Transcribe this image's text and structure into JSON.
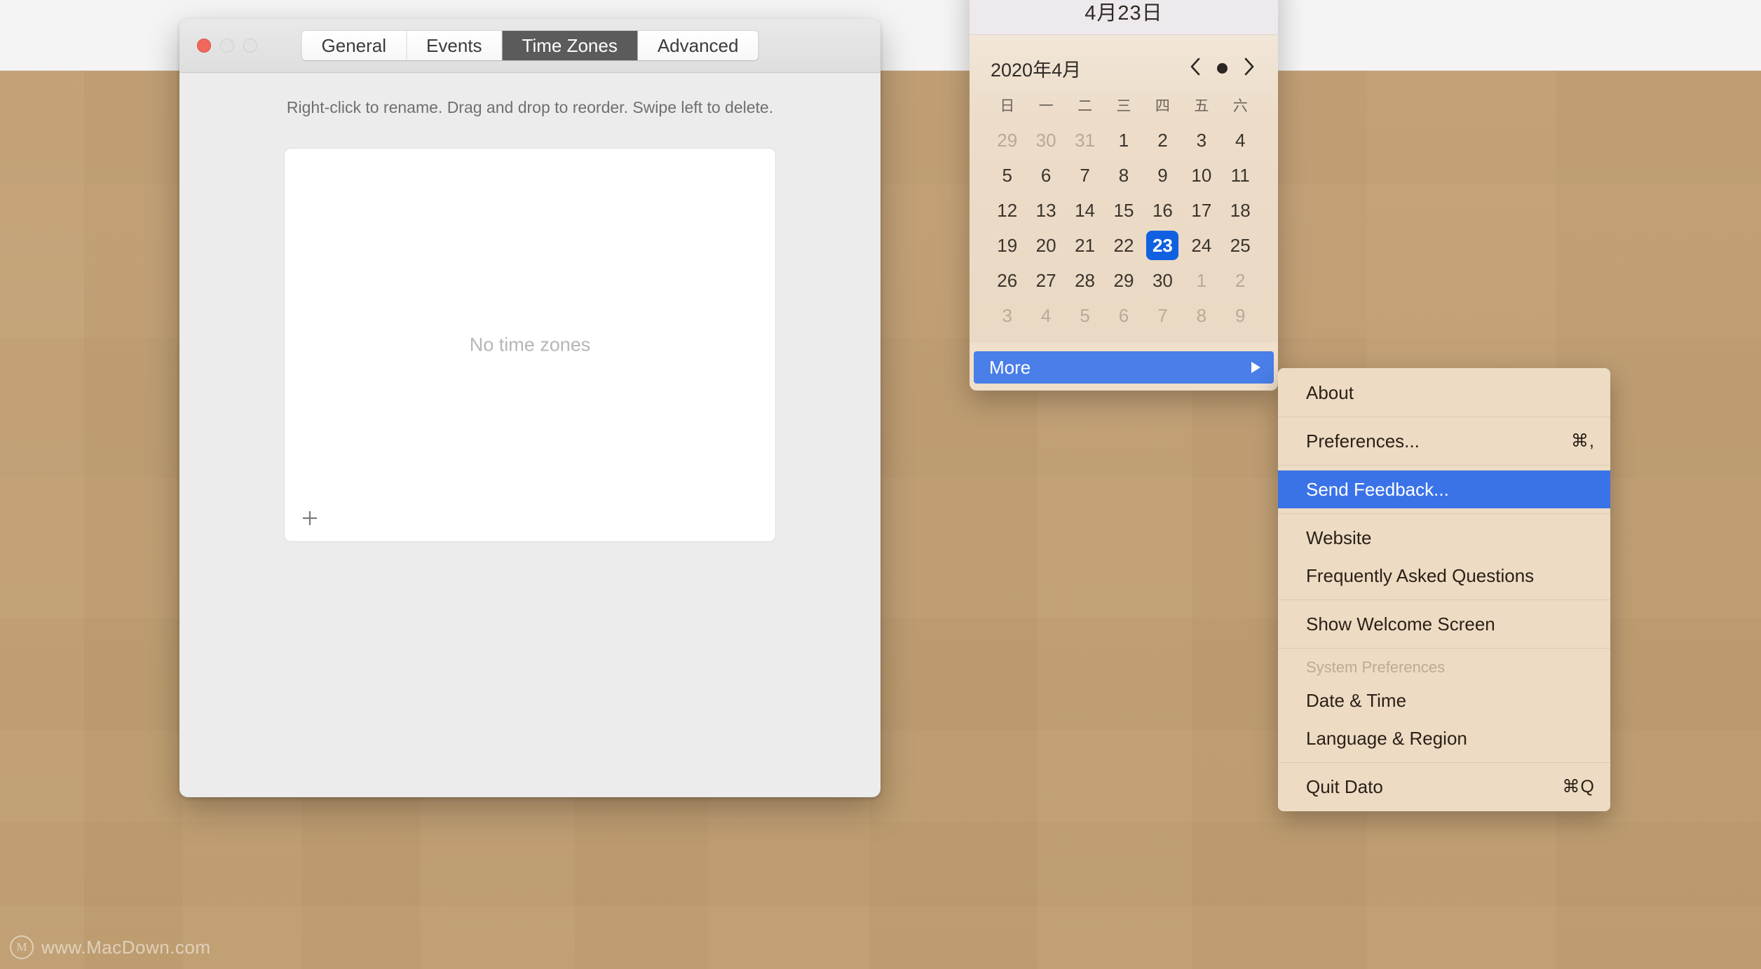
{
  "desktop": {
    "wallpaper_color": "#c3a176",
    "menubar_color": "#f4f4f5"
  },
  "watermark": {
    "logo_letter": "M",
    "text": "www.MacDown.com"
  },
  "prefs_window": {
    "traffic_lights": {
      "close_label": "close",
      "minimize_label": "minimize",
      "zoom_label": "zoom"
    },
    "tabs": [
      {
        "label": "General",
        "active": false
      },
      {
        "label": "Events",
        "active": false
      },
      {
        "label": "Time Zones",
        "active": true
      },
      {
        "label": "Advanced",
        "active": false
      }
    ],
    "hint": "Right-click to rename. Drag and drop to reorder. Swipe left to delete.",
    "empty_state": "No time zones",
    "add_button_label": "+"
  },
  "popover": {
    "header_title": "4月23日",
    "month_label": "2020年4月",
    "nav": {
      "prev": "‹",
      "today": "today-dot",
      "next": "›"
    },
    "weekdays": [
      "日",
      "一",
      "二",
      "三",
      "四",
      "五",
      "六"
    ],
    "weeks": [
      [
        {
          "d": "29",
          "out": true
        },
        {
          "d": "30",
          "out": true
        },
        {
          "d": "31",
          "out": true
        },
        {
          "d": "1",
          "out": false
        },
        {
          "d": "2",
          "out": false
        },
        {
          "d": "3",
          "out": false
        },
        {
          "d": "4",
          "out": false
        }
      ],
      [
        {
          "d": "5",
          "out": false
        },
        {
          "d": "6",
          "out": false
        },
        {
          "d": "7",
          "out": false
        },
        {
          "d": "8",
          "out": false
        },
        {
          "d": "9",
          "out": false
        },
        {
          "d": "10",
          "out": false
        },
        {
          "d": "11",
          "out": false
        }
      ],
      [
        {
          "d": "12",
          "out": false
        },
        {
          "d": "13",
          "out": false
        },
        {
          "d": "14",
          "out": false
        },
        {
          "d": "15",
          "out": false
        },
        {
          "d": "16",
          "out": false
        },
        {
          "d": "17",
          "out": false
        },
        {
          "d": "18",
          "out": false
        }
      ],
      [
        {
          "d": "19",
          "out": false
        },
        {
          "d": "20",
          "out": false
        },
        {
          "d": "21",
          "out": false
        },
        {
          "d": "22",
          "out": false
        },
        {
          "d": "23",
          "out": false,
          "selected": true
        },
        {
          "d": "24",
          "out": false
        },
        {
          "d": "25",
          "out": false
        }
      ],
      [
        {
          "d": "26",
          "out": false
        },
        {
          "d": "27",
          "out": false
        },
        {
          "d": "28",
          "out": false
        },
        {
          "d": "29",
          "out": false
        },
        {
          "d": "30",
          "out": false
        },
        {
          "d": "1",
          "out": true
        },
        {
          "d": "2",
          "out": true
        }
      ],
      [
        {
          "d": "3",
          "out": true
        },
        {
          "d": "4",
          "out": true
        },
        {
          "d": "5",
          "out": true
        },
        {
          "d": "6",
          "out": true
        },
        {
          "d": "7",
          "out": true
        },
        {
          "d": "8",
          "out": true
        },
        {
          "d": "9",
          "out": true
        }
      ]
    ],
    "more_row": {
      "label": "More",
      "selected": true,
      "has_submenu": true
    },
    "selected_day": "23",
    "accent_color": "#1160e0",
    "highlight_color": "#4a7ee8"
  },
  "submenu": {
    "highlight_color": "#3a72e8",
    "groups": [
      [
        {
          "label": "About",
          "shortcut": "",
          "selected": false,
          "section": false
        }
      ],
      [
        {
          "label": "Preferences...",
          "shortcut": "⌘,",
          "selected": false,
          "section": false
        }
      ],
      [
        {
          "label": "Send Feedback...",
          "shortcut": "",
          "selected": true,
          "section": false
        }
      ],
      [
        {
          "label": "Website",
          "shortcut": "",
          "selected": false,
          "section": false
        },
        {
          "label": "Frequently Asked Questions",
          "shortcut": "",
          "selected": false,
          "section": false
        }
      ],
      [
        {
          "label": "Show Welcome Screen",
          "shortcut": "",
          "selected": false,
          "section": false
        }
      ],
      [
        {
          "label": "System Preferences",
          "shortcut": "",
          "selected": false,
          "section": true
        },
        {
          "label": "Date & Time",
          "shortcut": "",
          "selected": false,
          "section": false
        },
        {
          "label": "Language & Region",
          "shortcut": "",
          "selected": false,
          "section": false
        }
      ],
      [
        {
          "label": "Quit Dato",
          "shortcut": "⌘Q",
          "selected": false,
          "section": false
        }
      ]
    ]
  }
}
